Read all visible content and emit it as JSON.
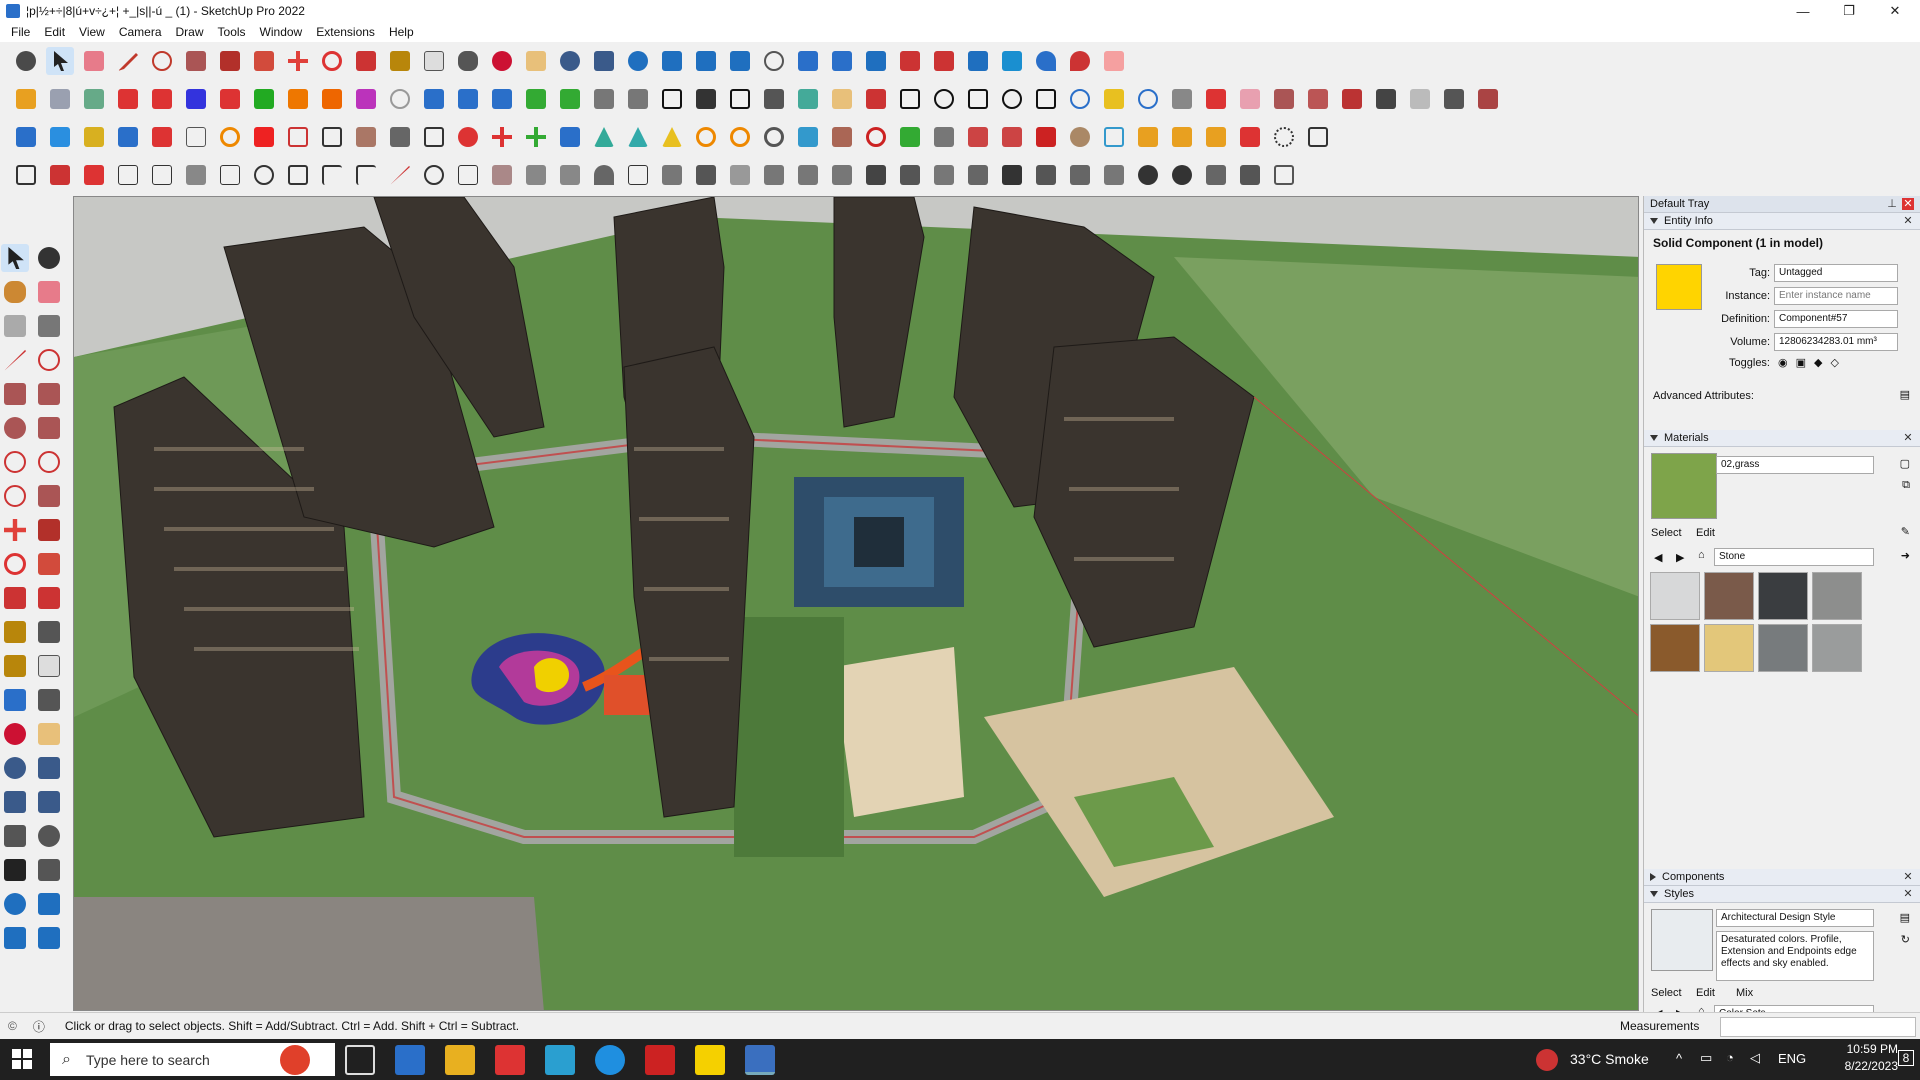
{
  "window": {
    "title": "¦p|½+÷|8|ú+v÷¿+¦ +_|s||-ú _ (1) - SketchUp Pro 2022",
    "minimize": "—",
    "maximize": "❐",
    "close": "✕"
  },
  "menu": [
    "File",
    "Edit",
    "View",
    "Camera",
    "Draw",
    "Tools",
    "Window",
    "Extensions",
    "Help"
  ],
  "tray": {
    "title": "Default Tray",
    "entity_info": {
      "header": "Entity Info",
      "heading": "Solid Component (1 in model)",
      "swatch_color": "#ffd400",
      "tag_label": "Tag:",
      "tag_value": "Untagged",
      "instance_label": "Instance:",
      "instance_placeholder": "Enter instance name",
      "definition_label": "Definition:",
      "definition_value": "Component#57",
      "volume_label": "Volume:",
      "volume_value": "12806234283.01 mm³",
      "toggles_label": "Toggles:",
      "advanced_label": "Advanced Attributes:"
    },
    "materials": {
      "header": "Materials",
      "name_value": "02,grass",
      "swatch_color": "#7ea44a",
      "tab_select": "Select",
      "tab_edit": "Edit",
      "library": "Stone",
      "swatches": [
        "#d7d8d9",
        "#7a5a4a",
        "#3a3d40",
        "#8d8e8d",
        "#8a5a2c",
        "#e3c77a",
        "#777b7d",
        "#9a9c9c"
      ]
    },
    "components": {
      "header": "Components"
    },
    "styles": {
      "header": "Styles",
      "name_value": "Architectural Design Style",
      "description": "Desaturated colors. Profile, Extension and Endpoints edge effects and sky enabled.",
      "tab_select": "Select",
      "tab_edit": "Edit",
      "tab_mix": "Mix",
      "collection": "Color Sets"
    }
  },
  "status": {
    "hint": "Click or drag to select objects. Shift = Add/Subtract. Ctrl = Add. Shift + Ctrl = Subtract.",
    "measurements_label": "Measurements"
  },
  "taskbar": {
    "search_placeholder": "Type here to search",
    "weather": "33°C  Smoke",
    "lang": "ENG",
    "time": "10:59 PM",
    "date": "8/22/2023",
    "notif_count": "8"
  },
  "colors": {
    "accent": "#2a6fc9",
    "grass": "#4f7b3a",
    "building": "#3a342e"
  }
}
